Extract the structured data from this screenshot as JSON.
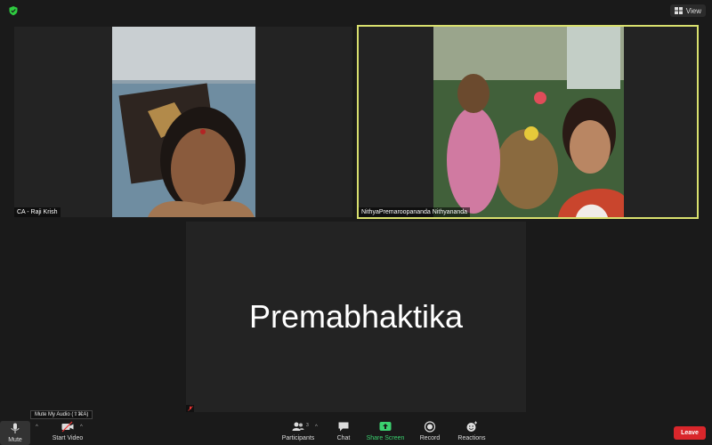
{
  "top_bar": {
    "security_icon": "shield-check-icon",
    "view_label": "View"
  },
  "participants_tiles": [
    {
      "name": "CA - Raji Krish",
      "active_speaker": false
    },
    {
      "name": "NithyaPremaroopananda Nithyananda",
      "active_speaker": true
    },
    {
      "name": "Premabhaktika",
      "video_off": true,
      "muted": true
    }
  ],
  "tooltip": "Mute My Audio (⇧⌘A)",
  "toolbar": {
    "mute_label": "Mute",
    "start_video_label": "Start Video",
    "participants_label": "Participants",
    "participants_count": "3",
    "chat_label": "Chat",
    "share_label": "Share Screen",
    "record_label": "Record",
    "reactions_label": "Reactions",
    "leave_label": "Leave"
  },
  "colors": {
    "active_speaker_border": "#d9e06e",
    "share_green": "#3bd16f",
    "leave_red": "#d9262b",
    "security_green": "#2ecc40"
  }
}
